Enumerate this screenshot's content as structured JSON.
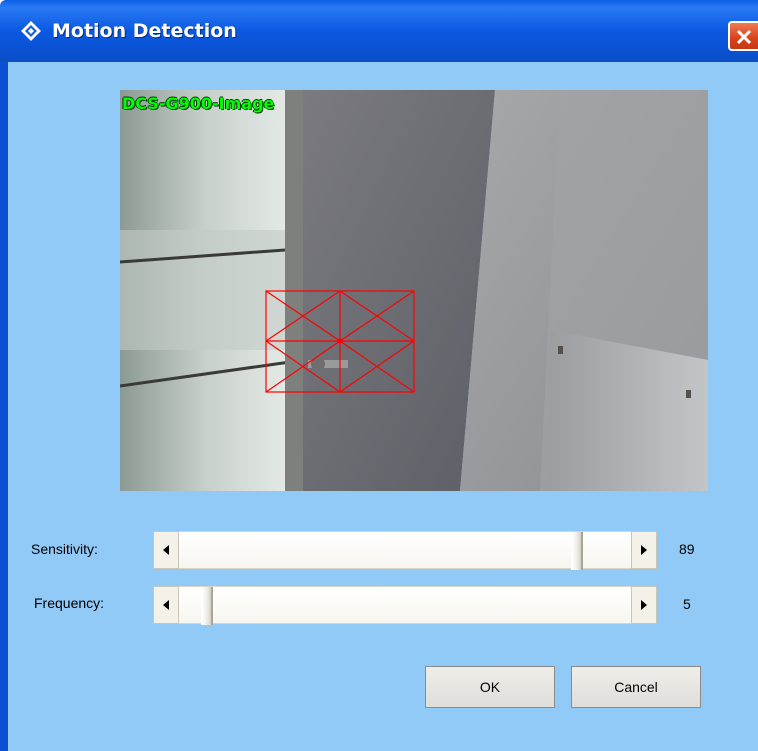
{
  "window": {
    "title": "Motion Detection",
    "icon": "diamond-app-icon",
    "close_icon": "close-x-icon"
  },
  "camera": {
    "overlay_label": "DCS-G900-Image",
    "label_color": "#00ff00",
    "motion_grid_color": "#ff0000",
    "motion_grid": {
      "rows": 2,
      "cols": 2
    }
  },
  "sensitivity": {
    "label": "Sensitivity:",
    "value": "89",
    "fraction": 0.89
  },
  "frequency": {
    "label": "Frequency:",
    "value": "5",
    "fraction": 0.05
  },
  "buttons": {
    "ok": "OK",
    "cancel": "Cancel"
  },
  "colors": {
    "titlebar": "#0b59e1",
    "client_bg": "#91c9f7",
    "close_button": "#d8421a"
  }
}
